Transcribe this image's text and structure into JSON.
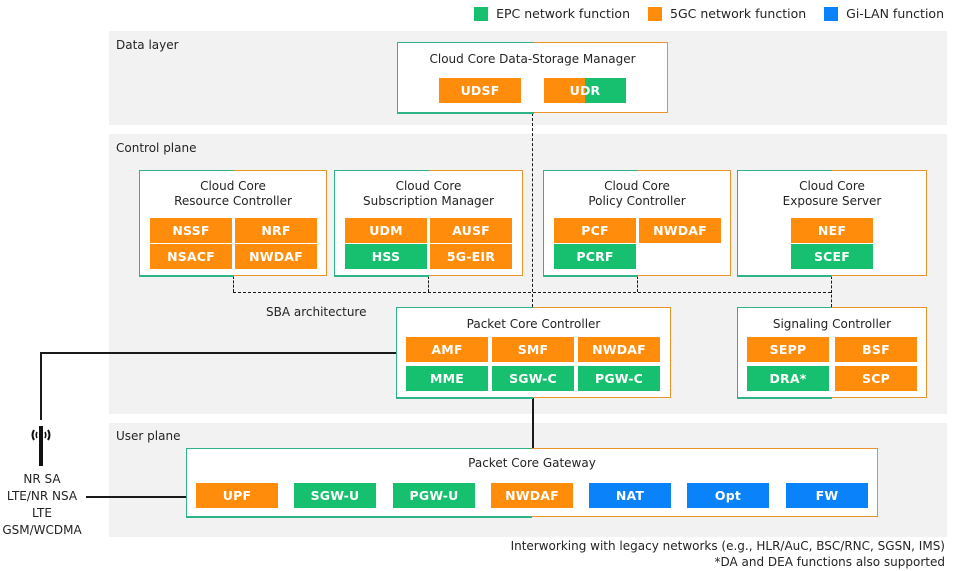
{
  "legend": [
    {
      "label": "EPC network function",
      "color": "#17c06f"
    },
    {
      "label": "5GC network function",
      "color": "#ff8c0a"
    },
    {
      "label": "Gi-LAN function",
      "color": "#0a82fa"
    }
  ],
  "layers": {
    "data": {
      "label": "Data layer"
    },
    "control": {
      "label": "Control plane"
    },
    "user": {
      "label": "User plane"
    }
  },
  "sba_label": "SBA architecture",
  "boxes": {
    "data_storage": {
      "title": "Cloud Core Data-Storage Manager",
      "functions": [
        {
          "label": "UDSF",
          "type": "5GC"
        },
        {
          "label": "UDR",
          "type": "5GC/EPC"
        }
      ]
    },
    "resource_controller": {
      "title": "Cloud Core\nResource Controller",
      "functions": [
        {
          "label": "NSSF",
          "type": "5GC"
        },
        {
          "label": "NRF",
          "type": "5GC"
        },
        {
          "label": "NSACF",
          "type": "5GC"
        },
        {
          "label": "NWDAF",
          "type": "5GC"
        }
      ]
    },
    "subscription_manager": {
      "title": "Cloud Core\nSubscription Manager",
      "functions": [
        {
          "label": "UDM",
          "type": "5GC"
        },
        {
          "label": "AUSF",
          "type": "5GC"
        },
        {
          "label": "HSS",
          "type": "EPC"
        },
        {
          "label": "5G-EIR",
          "type": "5GC"
        }
      ]
    },
    "policy_controller": {
      "title": "Cloud Core\nPolicy Controller",
      "functions": [
        {
          "label": "PCF",
          "type": "5GC"
        },
        {
          "label": "NWDAF",
          "type": "5GC"
        },
        {
          "label": "PCRF",
          "type": "EPC"
        }
      ]
    },
    "exposure_server": {
      "title": "Cloud Core\nExposure Server",
      "functions": [
        {
          "label": "NEF",
          "type": "5GC"
        },
        {
          "label": "SCEF",
          "type": "EPC"
        }
      ]
    },
    "packet_core_controller": {
      "title": "Packet Core Controller",
      "functions": [
        {
          "label": "AMF",
          "type": "5GC"
        },
        {
          "label": "SMF",
          "type": "5GC"
        },
        {
          "label": "NWDAF",
          "type": "5GC"
        },
        {
          "label": "MME",
          "type": "EPC"
        },
        {
          "label": "SGW-C",
          "type": "EPC"
        },
        {
          "label": "PGW-C",
          "type": "EPC"
        }
      ]
    },
    "signaling_controller": {
      "title": "Signaling Controller",
      "functions": [
        {
          "label": "SEPP",
          "type": "5GC"
        },
        {
          "label": "BSF",
          "type": "5GC"
        },
        {
          "label": "DRA*",
          "type": "EPC"
        },
        {
          "label": "SCP",
          "type": "5GC"
        }
      ]
    },
    "packet_core_gateway": {
      "title": "Packet Core Gateway",
      "functions": [
        {
          "label": "UPF",
          "type": "5GC"
        },
        {
          "label": "SGW-U",
          "type": "EPC"
        },
        {
          "label": "PGW-U",
          "type": "EPC"
        },
        {
          "label": "NWDAF",
          "type": "5GC"
        },
        {
          "label": "NAT",
          "type": "Gi-LAN"
        },
        {
          "label": "Opt",
          "type": "Gi-LAN"
        },
        {
          "label": "FW",
          "type": "Gi-LAN"
        }
      ]
    }
  },
  "radio": {
    "icon": "radio-tower-icon",
    "labels": [
      "NR SA",
      "LTE/NR NSA",
      "LTE",
      "GSM/WCDMA"
    ]
  },
  "footnotes": [
    "Interworking with legacy networks (e.g., HLR/AuC, BSC/RNC, SGSN, IMS)",
    "*DA and DEA functions also supported"
  ]
}
